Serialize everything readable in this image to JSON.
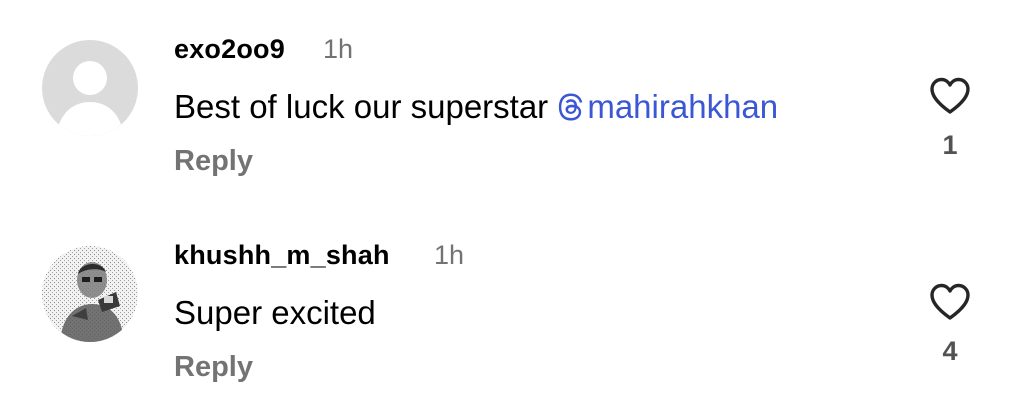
{
  "comments": [
    {
      "username": "exo2oo9",
      "time": "1h",
      "text": "Best of luck our superstar ",
      "mention_icon": "threads-icon",
      "mention": "mahirahkhan",
      "reply_label": "Reply",
      "like_icon": "heart-outline-icon",
      "likes": "1"
    },
    {
      "username": "khushh_m_shah",
      "time": "1h",
      "text": "Super excited",
      "reply_label": "Reply",
      "like_icon": "heart-outline-icon",
      "likes": "4"
    }
  ],
  "colors": {
    "mention": "#3b57d4",
    "secondary_text": "#737373",
    "count_text": "#525252",
    "default_avatar_bg": "#dbdbdb"
  }
}
